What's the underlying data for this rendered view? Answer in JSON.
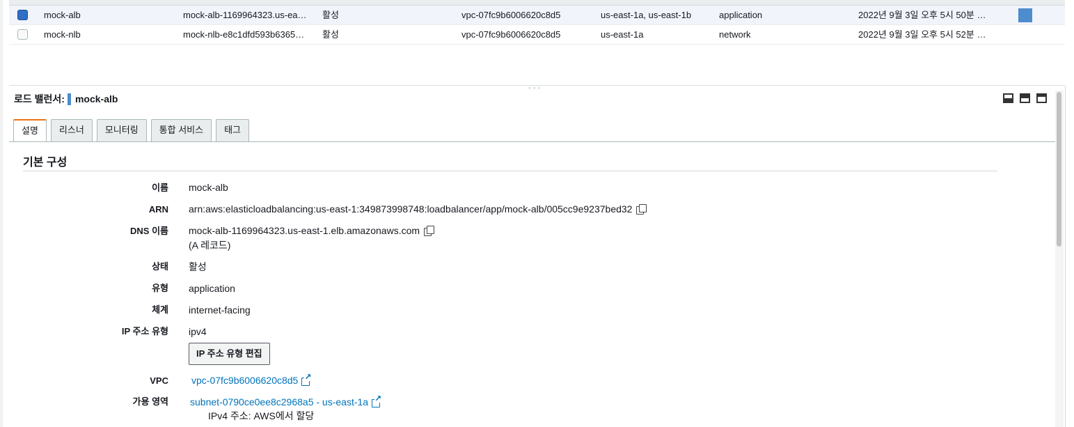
{
  "table": {
    "rows": [
      {
        "selected": true,
        "name": "mock-alb",
        "dns": "mock-alb-1169964323.us-ea…",
        "state": "활성",
        "vpc": "vpc-07fc9b6006620c8d5",
        "zones": "us-east-1a, us-east-1b",
        "type": "application",
        "created": "2022년 9월 3일 오후 5시 50분 …"
      },
      {
        "selected": false,
        "name": "mock-nlb",
        "dns": "mock-nlb-e8c1dfd593b6365…",
        "state": "활성",
        "vpc": "vpc-07fc9b6006620c8d5",
        "zones": "us-east-1a",
        "type": "network",
        "created": "2022년 9월 3일 오후 5시 52분 …"
      }
    ],
    "resize_grip": "∘∘∘"
  },
  "detail": {
    "label": "로드 밸런서:",
    "name": "mock-alb",
    "tabs": [
      "설명",
      "리스너",
      "모니터링",
      "통합 서비스",
      "태그"
    ],
    "active_tab": 0,
    "section_title": "기본 구성",
    "props": {
      "name_label": "이름",
      "name_value": "mock-alb",
      "arn_label": "ARN",
      "arn_value": "arn:aws:elasticloadbalancing:us-east-1:349873998748:loadbalancer/app/mock-alb/005cc9e9237bed32",
      "dns_label": "DNS 이름",
      "dns_value": "mock-alb-1169964323.us-east-1.elb.amazonaws.com",
      "dns_note": "(A 레코드)",
      "state_label": "상태",
      "state_value": "활성",
      "type_label": "유형",
      "type_value": "application",
      "scheme_label": "체계",
      "scheme_value": "internet-facing",
      "ip_label": "IP 주소 유형",
      "ip_value": "ipv4",
      "ip_edit_button": "IP 주소 유형 편집",
      "vpc_label": "VPC",
      "vpc_value": "vpc-07fc9b6006620c8d5",
      "az_label": "가용 영역",
      "az_value": "subnet-0790ce0ee8c2968a5 - us-east-1a",
      "az_note": "IPv4 주소: AWS에서 할당"
    }
  },
  "icons": [
    "checkbox-icon",
    "copy-icon",
    "external-link-icon",
    "panel-view-icon"
  ],
  "colors": {
    "accent_tab": "#ec7211",
    "link": "#0073bb",
    "selected_checkbox": "#2f6fc5",
    "selected_row": "#f1f4fa",
    "name_marker": "#4d8ccd"
  }
}
